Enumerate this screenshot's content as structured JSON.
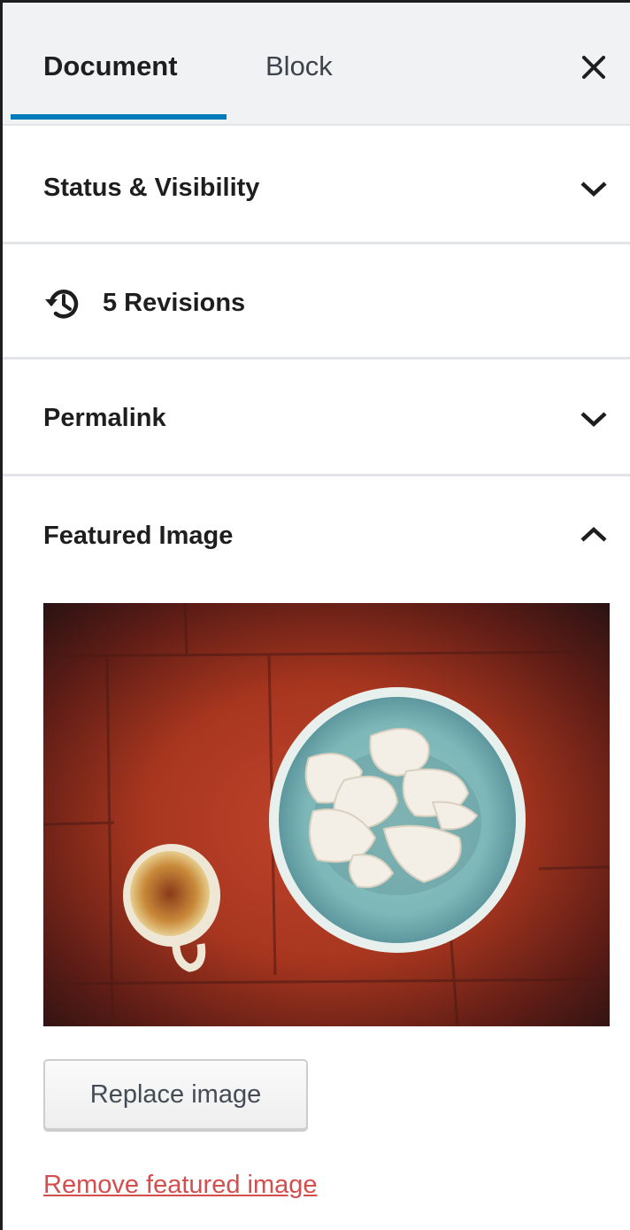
{
  "tabs": {
    "document_label": "Document",
    "block_label": "Block",
    "active": "Document"
  },
  "close_icon": "close-icon",
  "panels": {
    "status": {
      "title": "Status & Visibility",
      "expanded": false,
      "icon": "chevron-down-icon"
    },
    "revisions": {
      "label": "5 Revisions",
      "icon": "history-icon"
    },
    "permalink": {
      "title": "Permalink",
      "expanded": false,
      "icon": "chevron-down-icon"
    },
    "featured": {
      "title": "Featured Image",
      "expanded": true,
      "icon": "chevron-up-icon",
      "replace_label": "Replace image",
      "remove_label": "Remove featured image"
    }
  },
  "colors": {
    "accent": "#007cba",
    "danger_link": "#d54e4e",
    "tab_bar_bg": "#f0f2f4",
    "divider": "#e2e4e7"
  }
}
